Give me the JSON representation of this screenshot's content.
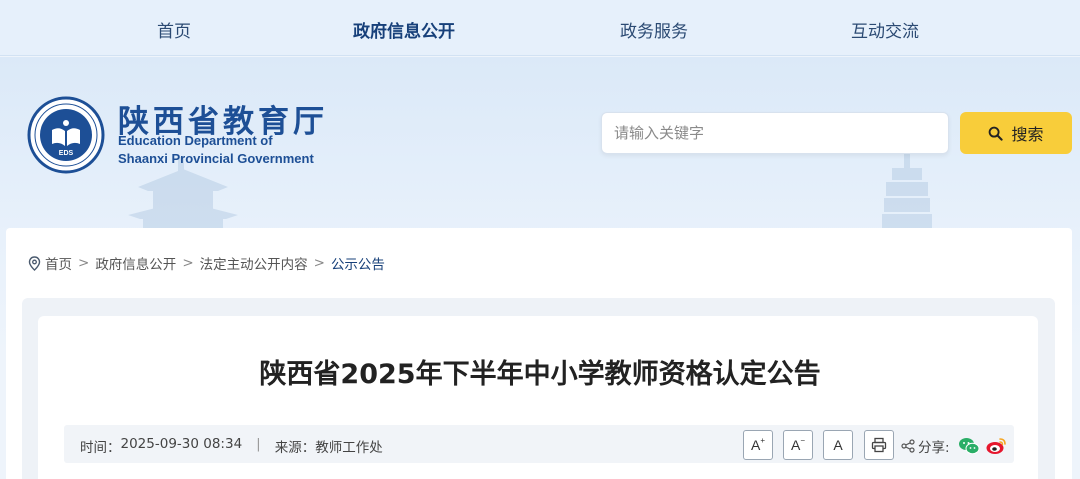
{
  "nav": {
    "items": [
      {
        "label": "首页"
      },
      {
        "label": "政府信息公开"
      },
      {
        "label": "政务服务"
      },
      {
        "label": "互动交流"
      }
    ]
  },
  "header": {
    "logo_cn": "陕西省教育厅",
    "logo_en_line1": "Education Department of",
    "logo_en_line2": "Shaanxi Provincial Government",
    "emblem_text": "EDS"
  },
  "search": {
    "placeholder": "请输入关键字",
    "button_label": "搜索"
  },
  "breadcrumb": {
    "items": [
      "首页",
      "政府信息公开",
      "法定主动公开内容",
      "公示公告"
    ],
    "separator": ">"
  },
  "article": {
    "title": "陕西省2025年下半年中小学教师资格认定公告",
    "time_label": "时间：",
    "time_value": "2025-09-30 08:34",
    "divider": "|",
    "source_label": "来源：",
    "source_value": "教师工作处"
  },
  "tools": {
    "font_larger": "A",
    "font_smaller": "A",
    "font_default": "A",
    "share_label": "分享:"
  },
  "colors": {
    "brand_blue": "#1d4f96",
    "search_button": "#f8cd3a",
    "wechat_green": "#2aae67",
    "weibo_red": "#e6162d"
  }
}
